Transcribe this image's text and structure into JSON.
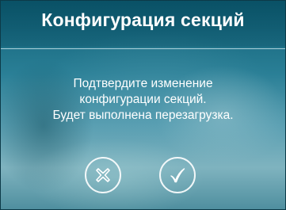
{
  "dialog": {
    "title": "Конфигурация секций",
    "message_lines": [
      "Подтвердите изменение",
      "конфигурации секций.",
      "Будет выполнена перезагрузка."
    ],
    "cancel_icon": "close-icon",
    "confirm_icon": "checkmark-icon"
  },
  "colors": {
    "accent": "#1f6f86",
    "text": "#ffffff"
  }
}
